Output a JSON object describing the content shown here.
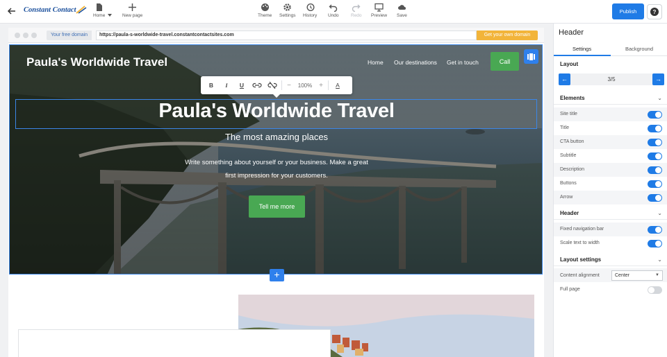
{
  "toolbar": {
    "logo": "Constant Contact",
    "home": "Home",
    "new_page": "New page",
    "theme": "Theme",
    "settings": "Settings",
    "history": "History",
    "undo": "Undo",
    "redo": "Redo",
    "preview": "Preview",
    "save": "Save",
    "publish": "Publish",
    "help": "?"
  },
  "browser": {
    "free_domain": "Your free domain",
    "url": "https://paula-s-worldwide-travel.constantcontactsites.com",
    "get_domain": "Get your own domain"
  },
  "hero": {
    "site_title": "Paula's Worldwide Travel",
    "nav": [
      "Home",
      "Our destinations",
      "Get in touch"
    ],
    "call": "Call",
    "title": "Paula's Worldwide Travel",
    "subtitle": "The most amazing places",
    "description_line1": "Write something about yourself or your business. Make a great",
    "description_line2": "first impression for your customers.",
    "cta": "Tell me more",
    "add_section": "+"
  },
  "format_bar": {
    "bold": "B",
    "italic": "I",
    "underline": "U",
    "minus": "−",
    "zoom": "100%",
    "plus": "+",
    "color": "A"
  },
  "panel": {
    "title": "Header",
    "tabs": [
      "Settings",
      "Background"
    ],
    "layout": {
      "heading": "Layout",
      "value": "3/5"
    },
    "elements": {
      "heading": "Elements",
      "items": [
        {
          "label": "Site title",
          "on": true
        },
        {
          "label": "Title",
          "on": true
        },
        {
          "label": "CTA button",
          "on": true
        },
        {
          "label": "Subtitle",
          "on": true
        },
        {
          "label": "Description",
          "on": true
        },
        {
          "label": "Buttons",
          "on": true
        },
        {
          "label": "Arrow",
          "on": true
        }
      ]
    },
    "header": {
      "heading": "Header",
      "items": [
        {
          "label": "Fixed navigation bar",
          "on": true
        },
        {
          "label": "Scale text to width",
          "on": true
        }
      ]
    },
    "layout_settings": {
      "heading": "Layout settings",
      "alignment_label": "Content alignment",
      "alignment_value": "Center",
      "full_page_label": "Full page",
      "full_page_on": false
    }
  },
  "colors": {
    "accent": "#1f7be6",
    "green": "#49a853",
    "domain_orange": "#f2b43a"
  }
}
